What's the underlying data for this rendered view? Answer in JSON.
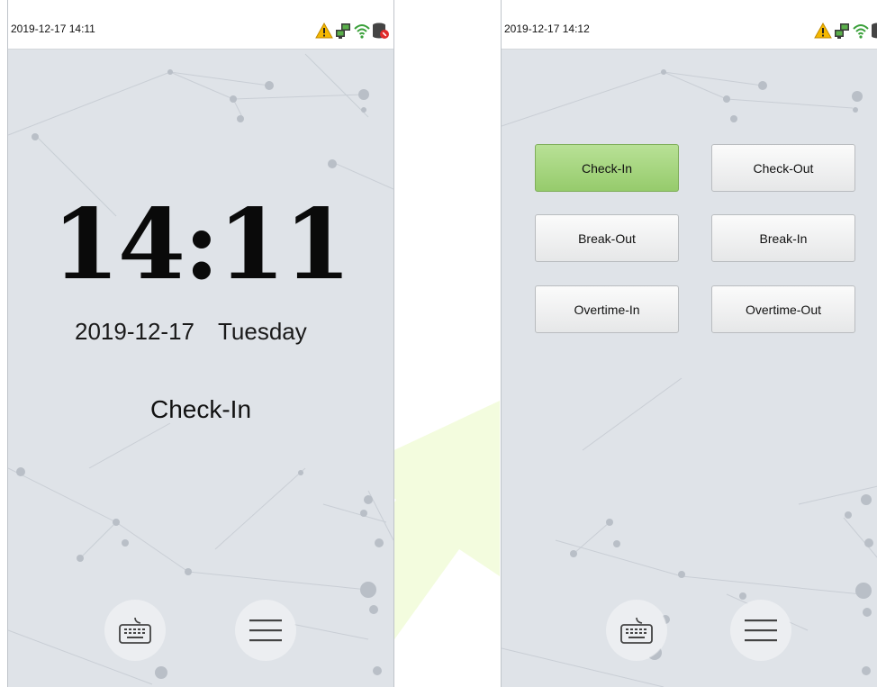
{
  "left_screen": {
    "status_time": "2019-12-17 14:11",
    "clock": "14:11",
    "date": "2019-12-17",
    "weekday": "Tuesday",
    "state": "Check-In",
    "icons": [
      "warning-icon",
      "network-icon",
      "wifi-icon",
      "database-error-icon"
    ],
    "bottom_buttons": [
      "keyboard-icon",
      "menu-icon"
    ]
  },
  "right_screen": {
    "status_time": "2019-12-17 14:12",
    "icons": [
      "warning-icon",
      "network-icon",
      "wifi-icon",
      "database-error-icon"
    ],
    "state_buttons": [
      "Check-In",
      "Check-Out",
      "Break-Out",
      "Break-In",
      "Overtime-In",
      "Overtime-Out"
    ],
    "selected_state": "Check-In",
    "bottom_buttons": [
      "keyboard-icon",
      "menu-icon"
    ]
  },
  "colors": {
    "screen_bg": "#dfe3e8",
    "active_button": "#a6d67c",
    "background_arrow": "#f4fde0"
  }
}
